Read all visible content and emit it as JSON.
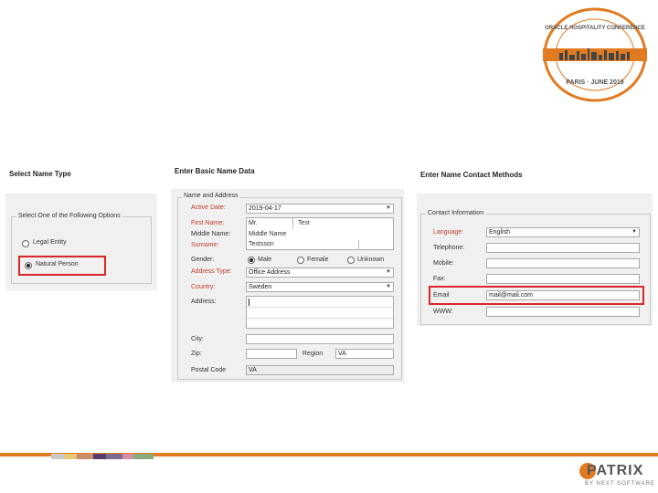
{
  "panel1": {
    "heading": "Select Name Type",
    "group_title": "Select One of the Following Options",
    "options": [
      "Legal Entity",
      "Natural Person"
    ],
    "selected": "Natural Person"
  },
  "panel2": {
    "heading": "Enter Basic Name Data",
    "group_title": "Name and Address",
    "labels": {
      "active_date": "Active Date:",
      "first_name": "First Name:",
      "middle_name": "Middle Name:",
      "surname": "Surname:",
      "gender": "Gender:",
      "address_type": "Address Type:",
      "country": "Country:",
      "address": "Address:",
      "city": "City:",
      "zip": "Zip:",
      "region": "Region",
      "postal_code": "Postal Code"
    },
    "values": {
      "active_date": "2019-04-17",
      "name_prefix": "Mr.",
      "first_name": "Test",
      "middle_name": "Middle Name",
      "surname": "Testsson",
      "address_type": "Office Address",
      "country": "Sweden",
      "region": "VA",
      "postal_code": "VA"
    },
    "gender_options": [
      "Male",
      "Female",
      "Unknown"
    ],
    "gender_selected": "Male"
  },
  "panel3": {
    "heading": "Enter Name Contact Methods",
    "group_title": "Contact Information",
    "labels": {
      "language": "Language:",
      "telephone": "Telephone:",
      "mobile": "Mobile:",
      "fax": "Fax:",
      "email": "Email",
      "www": "WWW:"
    },
    "values": {
      "language": "English",
      "email": "mail@mail.com"
    }
  },
  "badge": {
    "top_text": "ORACLE HOSPITALITY CONFERENCE",
    "bottom_text": "PARIS · JUNE 2019"
  },
  "footer": {
    "logo_text": "PATRIX",
    "logo_sub": "BY NEXT SOFTWARE",
    "accent_color": "#e07b22",
    "squares": [
      "#c9c9c9",
      "#e6c77a",
      "#c98f6d",
      "#5b3a6e",
      "#7a6c8c",
      "#d78ea5",
      "#8aaa7a"
    ]
  }
}
